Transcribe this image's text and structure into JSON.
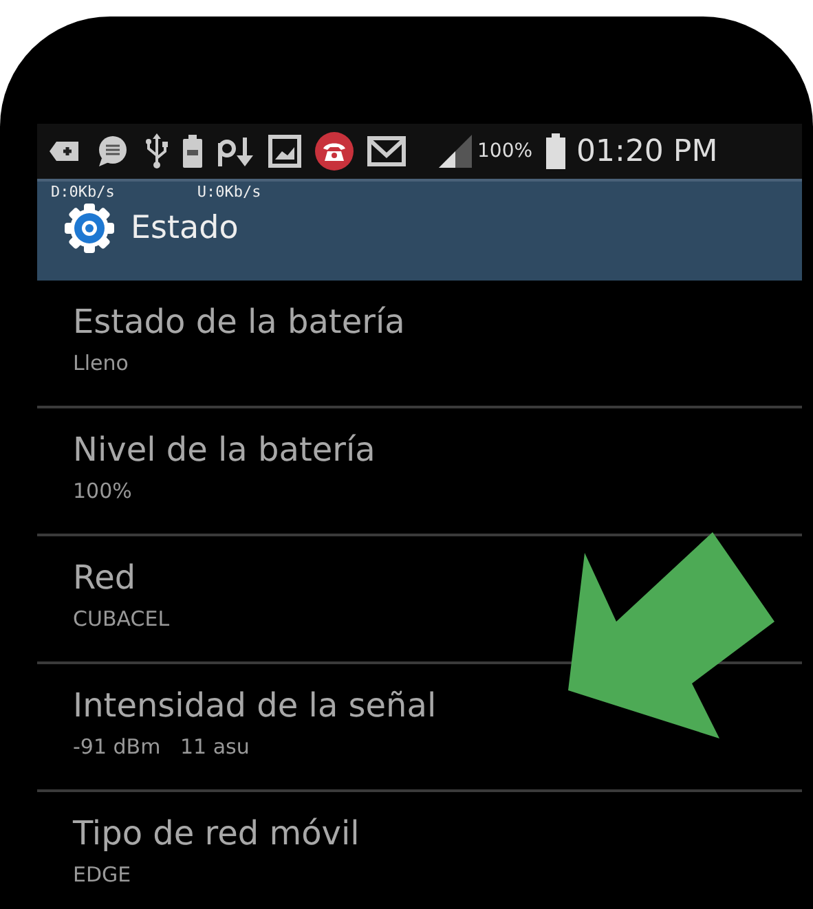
{
  "status_bar": {
    "battery_percent": "100%",
    "time": "01:20 PM"
  },
  "network_speed": {
    "download": "D:0Kb/s",
    "upload": "U:0Kb/s"
  },
  "header": {
    "title": "Estado"
  },
  "items": [
    {
      "title": "Estado de la batería",
      "value": "Lleno"
    },
    {
      "title": "Nivel de la batería",
      "value": "100%"
    },
    {
      "title": "Red",
      "value": "CUBACEL"
    },
    {
      "title": "Intensidad de la señal",
      "value": "-91 dBm   11 asu"
    },
    {
      "title": "Tipo de red móvil",
      "value": "EDGE"
    }
  ]
}
